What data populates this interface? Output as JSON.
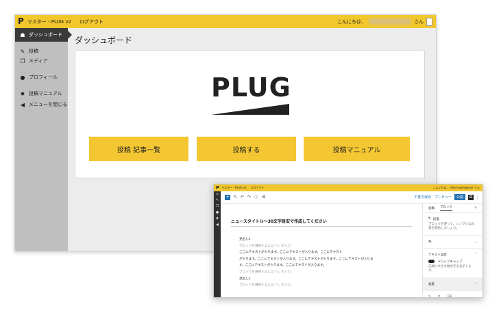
{
  "admin": {
    "topbar": {
      "logo": "P",
      "site_name": "マスター - PLUG v2",
      "logout": "ログアウト",
      "greeting": "こんにちは、",
      "honorific": "さん"
    },
    "sidebar": {
      "items": [
        {
          "icon": "dashboard-icon",
          "glyph": "☗",
          "label": "ダッシュボード"
        },
        {
          "icon": "pin-icon",
          "glyph": "✎",
          "label": "投稿"
        },
        {
          "icon": "media-icon",
          "glyph": "❐",
          "label": "メディア"
        },
        {
          "icon": "user-icon",
          "glyph": "●",
          "label": "プロフィール"
        },
        {
          "icon": "gear-icon",
          "glyph": "✹",
          "label": "投稿マニュアル"
        },
        {
          "icon": "collapse-icon",
          "glyph": "◀",
          "label": "メニューを閉じる"
        }
      ]
    },
    "page_title": "ダッシュボード",
    "logo_text": "PLUG",
    "buttons": {
      "posts_list": "投稿 記事一覧",
      "new_post": "投稿する",
      "manual": "投稿マニュアル"
    }
  },
  "editor": {
    "topbar": {
      "logo": "P",
      "site_name": "マスター - PLUG v2",
      "logout": "ログアウト",
      "user": "こんにちは、client-open@user さん"
    },
    "toolbar": {
      "save_draft": "下書き保存",
      "preview": "プレビュー",
      "publish": "公開"
    },
    "post_title": "ニュースタイトル〜30文字目安で作成してください",
    "body_lines": [
      {
        "text": "見出し1",
        "muted": false
      },
      {
        "text": "ブロックを選択するには「/」を入力",
        "muted": true
      },
      {
        "text": "ここにテキストが入ります。ここにテキストが入ります。ここにテキスト",
        "muted": false
      },
      {
        "text": "が入ります。ここにテキストが入ります。ここにテキストが入ります。ここにテキストが入りま",
        "muted": false
      },
      {
        "text": "す。ここにテキストが入ります。ここにテキストが入ります。",
        "muted": false
      },
      {
        "text": "ブロックを選択するには「/」を入力",
        "muted": true
      },
      {
        "text": "見出し2",
        "muted": false
      },
      {
        "text": "ブロックを選択するには「/」を入力",
        "muted": true
      }
    ],
    "panel": {
      "tab_post": "投稿",
      "tab_block": "ブロック",
      "close": "×",
      "block_name": "段落",
      "block_desc": "ブロックを使って、シンプルな段落を開始しましょう。",
      "color_label": "色",
      "text_settings": "テキスト設定",
      "drop_cap": "ドロップキャップ",
      "drop_cap_desc": "先頭に大きな頭文字を表示します。",
      "advanced": "高度"
    }
  }
}
